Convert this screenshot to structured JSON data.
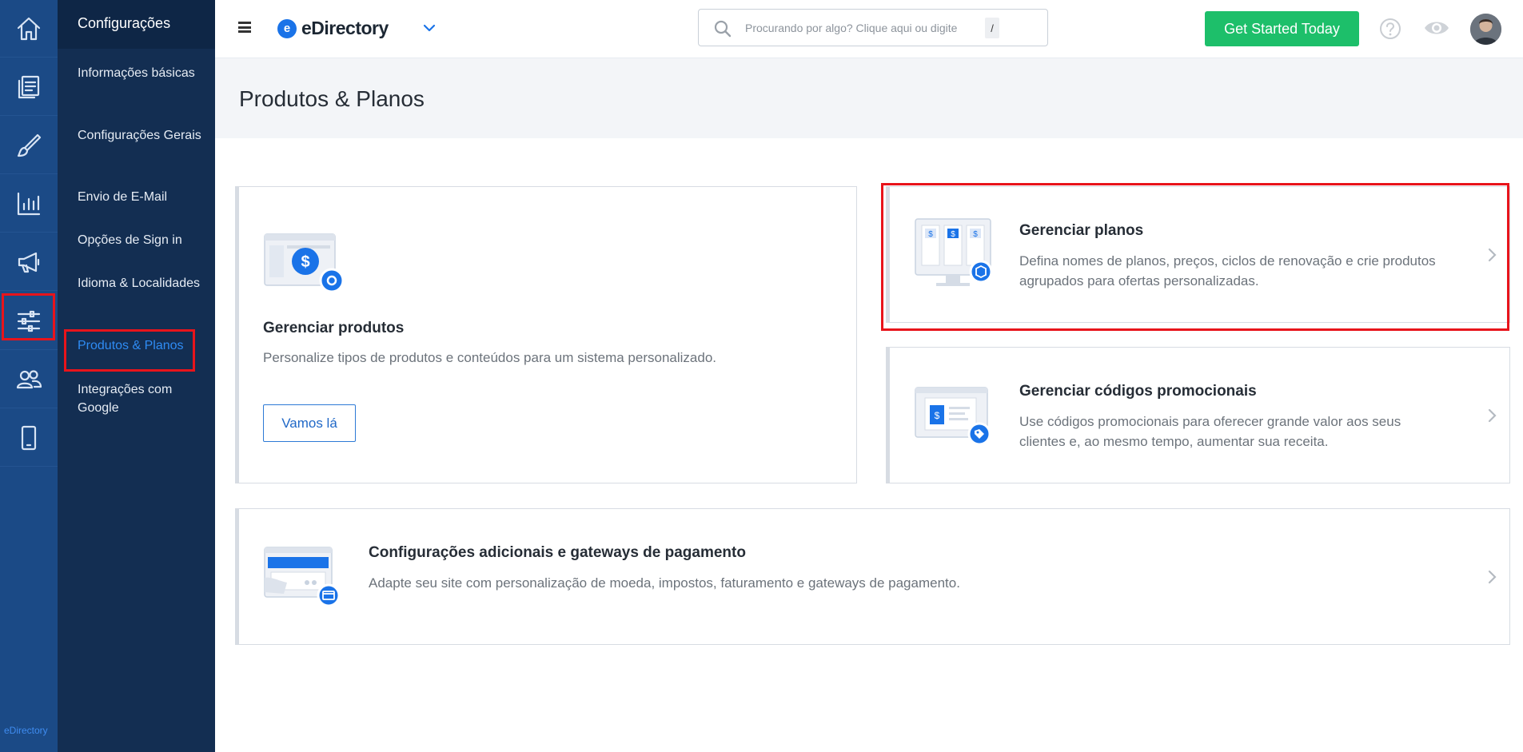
{
  "rail": {
    "items": [
      {
        "name": "home-icon"
      },
      {
        "name": "content-icon"
      },
      {
        "name": "design-icon"
      },
      {
        "name": "reports-icon"
      },
      {
        "name": "promote-icon"
      },
      {
        "name": "settings-icon"
      },
      {
        "name": "users-icon"
      },
      {
        "name": "mobile-icon"
      }
    ],
    "footer": "eDirectory"
  },
  "sidebar": {
    "title": "Configurações",
    "items": [
      {
        "label": "Informações básicas"
      },
      {
        "label": "Configurações Gerais"
      },
      {
        "label": "Envio de E-Mail"
      },
      {
        "label": "Opções de Sign in"
      },
      {
        "label": "Idioma & Localidades"
      },
      {
        "label": "Produtos & Planos",
        "active": true
      },
      {
        "label": "Integrações com Google"
      }
    ]
  },
  "topbar": {
    "logo_mark": "e",
    "brand": "eDirectory",
    "search_placeholder": "Procurando por algo? Clique aqui ou digite",
    "search_shortcut": "/",
    "cta_label": "Get Started Today"
  },
  "page": {
    "title": "Produtos & Planos"
  },
  "cards": {
    "products": {
      "title": "Gerenciar produtos",
      "description": "Personalize tipos de produtos e conteúdos para um sistema personalizado.",
      "button": "Vamos lá"
    },
    "plans": {
      "title": "Gerenciar planos",
      "description_line1": "Defina nomes de planos, preços, ciclos de renovação e crie produtos",
      "description_line2": "agrupados para ofertas personalizadas."
    },
    "promo": {
      "title": "Gerenciar códigos promocionais",
      "description_line1": "Use códigos promocionais para oferecer grande valor aos seus",
      "description_line2": "clientes e, ao mesmo tempo, aumentar sua receita."
    },
    "payments": {
      "title": "Configurações adicionais e gateways de pagamento",
      "description": "Adapte seu site com personalização de moeda, impostos, faturamento e gateways de pagamento."
    }
  },
  "colors": {
    "rail_bg": "#1b4a86",
    "sidebar_bg": "#132e52",
    "active_link": "#2f8cf4",
    "cta_green": "#1dbf6a",
    "highlight_red": "#e8141b",
    "accent_blue": "#1a73e8"
  }
}
